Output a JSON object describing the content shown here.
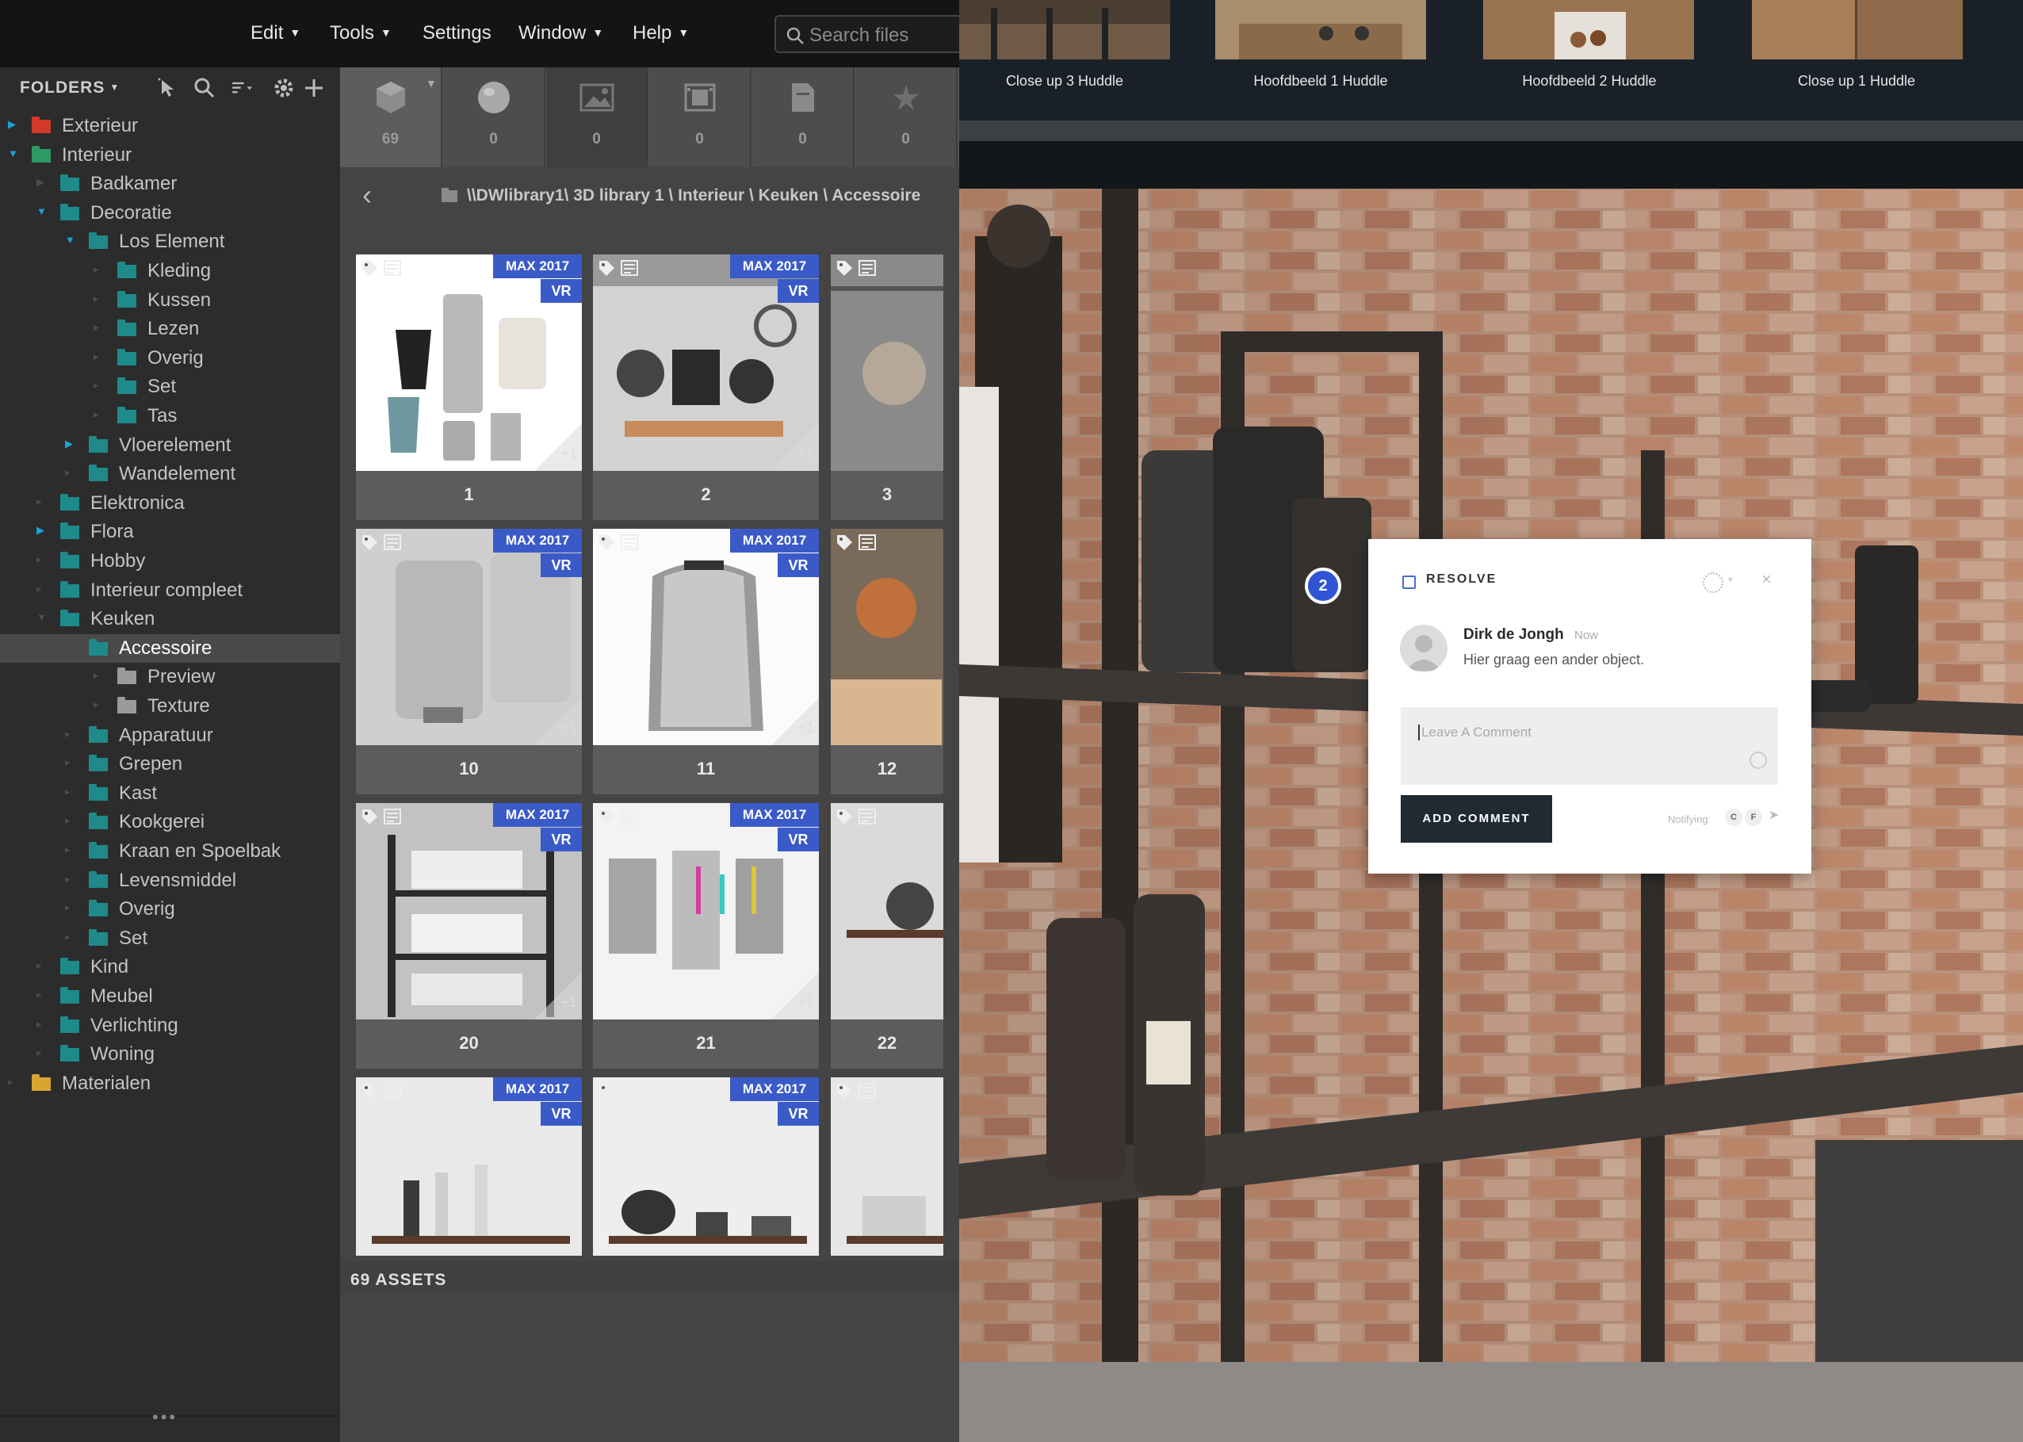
{
  "menubar": {
    "items": [
      "Edit",
      "Tools",
      "Settings",
      "Window",
      "Help"
    ],
    "search_placeholder": "Search files"
  },
  "folders_panel": {
    "title": "FOLDERS",
    "tree": [
      {
        "label": "Exterieur",
        "level": 0,
        "state": "closed",
        "icon": "folder-red"
      },
      {
        "label": "Interieur",
        "level": 0,
        "state": "open",
        "icon": "folder-green"
      },
      {
        "label": "Badkamer",
        "level": 1,
        "state": "closed",
        "icon": "folder-teal"
      },
      {
        "label": "Decoratie",
        "level": 1,
        "state": "open",
        "icon": "folder-teal"
      },
      {
        "label": "Los Element",
        "level": 2,
        "state": "open",
        "icon": "folder-teal"
      },
      {
        "label": "Kleding",
        "level": 3,
        "state": "none",
        "icon": "folder-teal"
      },
      {
        "label": "Kussen",
        "level": 3,
        "state": "none",
        "icon": "folder-teal"
      },
      {
        "label": "Lezen",
        "level": 3,
        "state": "none",
        "icon": "folder-teal"
      },
      {
        "label": "Overig",
        "level": 3,
        "state": "none",
        "icon": "folder-teal"
      },
      {
        "label": "Set",
        "level": 3,
        "state": "none",
        "icon": "folder-teal"
      },
      {
        "label": "Tas",
        "level": 3,
        "state": "none",
        "icon": "folder-teal"
      },
      {
        "label": "Vloerelement",
        "level": 2,
        "state": "closed-blue",
        "icon": "folder-teal"
      },
      {
        "label": "Wandelement",
        "level": 2,
        "state": "none",
        "icon": "folder-teal"
      },
      {
        "label": "Elektronica",
        "level": 1,
        "state": "none",
        "icon": "folder-teal"
      },
      {
        "label": "Flora",
        "level": 1,
        "state": "closed-blue",
        "icon": "folder-teal"
      },
      {
        "label": "Hobby",
        "level": 1,
        "state": "none",
        "icon": "folder-teal"
      },
      {
        "label": "Interieur compleet",
        "level": 1,
        "state": "none",
        "icon": "folder-teal"
      },
      {
        "label": "Keuken",
        "level": 1,
        "state": "open-dim",
        "icon": "folder-teal"
      },
      {
        "label": "Accessoire",
        "level": 2,
        "state": "open-dim",
        "icon": "folder-teal",
        "selected": true
      },
      {
        "label": "Preview",
        "level": 3,
        "state": "none",
        "icon": "folder-grey"
      },
      {
        "label": "Texture",
        "level": 3,
        "state": "none",
        "icon": "folder-grey"
      },
      {
        "label": "Apparatuur",
        "level": 2,
        "state": "none",
        "icon": "folder-teal"
      },
      {
        "label": "Grepen",
        "level": 2,
        "state": "none",
        "icon": "folder-teal"
      },
      {
        "label": "Kast",
        "level": 2,
        "state": "none",
        "icon": "folder-teal"
      },
      {
        "label": "Kookgerei",
        "level": 2,
        "state": "none",
        "icon": "folder-teal"
      },
      {
        "label": "Kraan en Spoelbak",
        "level": 2,
        "state": "none",
        "icon": "folder-teal"
      },
      {
        "label": "Levensmiddel",
        "level": 2,
        "state": "none",
        "icon": "folder-teal"
      },
      {
        "label": "Overig",
        "level": 2,
        "state": "none",
        "icon": "folder-teal"
      },
      {
        "label": "Set",
        "level": 2,
        "state": "none",
        "icon": "folder-teal"
      },
      {
        "label": "Kind",
        "level": 1,
        "state": "none",
        "icon": "folder-teal"
      },
      {
        "label": "Meubel",
        "level": 1,
        "state": "none",
        "icon": "folder-teal"
      },
      {
        "label": "Verlichting",
        "level": 1,
        "state": "none",
        "icon": "folder-teal"
      },
      {
        "label": "Woning",
        "level": 1,
        "state": "none",
        "icon": "folder-teal"
      },
      {
        "label": "Materialen",
        "level": 0,
        "state": "none",
        "icon": "folder-yellow"
      }
    ]
  },
  "browser": {
    "type_tabs": [
      {
        "icon": "cube-icon",
        "count": "69"
      },
      {
        "icon": "sphere-icon",
        "count": "0"
      },
      {
        "icon": "image-icon",
        "count": "0"
      },
      {
        "icon": "film-icon",
        "count": "0"
      },
      {
        "icon": "document-icon",
        "count": "0"
      },
      {
        "icon": "star-icon",
        "count": "0"
      }
    ],
    "path": "\\\\DWlibrary1\\ 3D library 1 \\ Interieur \\ Keuken \\ Accessoire",
    "cards": [
      {
        "number": "1",
        "max": "MAX 2017",
        "vr": "VR",
        "plus": "+1"
      },
      {
        "number": "2",
        "max": "MAX 2017",
        "vr": "VR",
        "plus": "+1"
      },
      {
        "number": "3",
        "max": "",
        "vr": "",
        "plus": ""
      },
      {
        "number": "10",
        "max": "MAX 2017",
        "vr": "VR",
        "plus": "+1"
      },
      {
        "number": "11",
        "max": "MAX 2017",
        "vr": "VR",
        "plus": "+1"
      },
      {
        "number": "12",
        "max": "",
        "vr": "",
        "plus": ""
      },
      {
        "number": "20",
        "max": "MAX 2017",
        "vr": "VR",
        "plus": "+1"
      },
      {
        "number": "21",
        "max": "MAX 2017",
        "vr": "VR",
        "plus": "+1"
      },
      {
        "number": "22",
        "max": "",
        "vr": "",
        "plus": ""
      },
      {
        "number": "",
        "max": "MAX 2017",
        "vr": "VR",
        "plus": ""
      },
      {
        "number": "",
        "max": "MAX 2017",
        "vr": "VR",
        "plus": ""
      },
      {
        "number": "",
        "max": "",
        "vr": "",
        "plus": ""
      }
    ],
    "assets_count": "69 ASSETS"
  },
  "viewer": {
    "strip": [
      "Close up 3 Huddle",
      "Hoofdbeeld 1 Huddle",
      "Hoofdbeeld 2 Huddle",
      "Close up 1 Huddle"
    ],
    "marker_number": "2",
    "comment": {
      "resolve_label": "RESOLVE",
      "author": "Dirk de Jongh",
      "time": "Now",
      "text": "Hier graag een ander object.",
      "placeholder": "Leave A Comment",
      "add_button": "ADD COMMENT",
      "notify_label": "Notifying",
      "notify_tags": [
        "C",
        "F"
      ]
    }
  },
  "colors": {
    "accent_blue": "#3a5bc7",
    "tree_arrow_blue": "#1aa3d9",
    "folder_teal": "#1f8a8a",
    "marker_blue": "#2f55d4",
    "button_dark": "#1f2a33"
  }
}
